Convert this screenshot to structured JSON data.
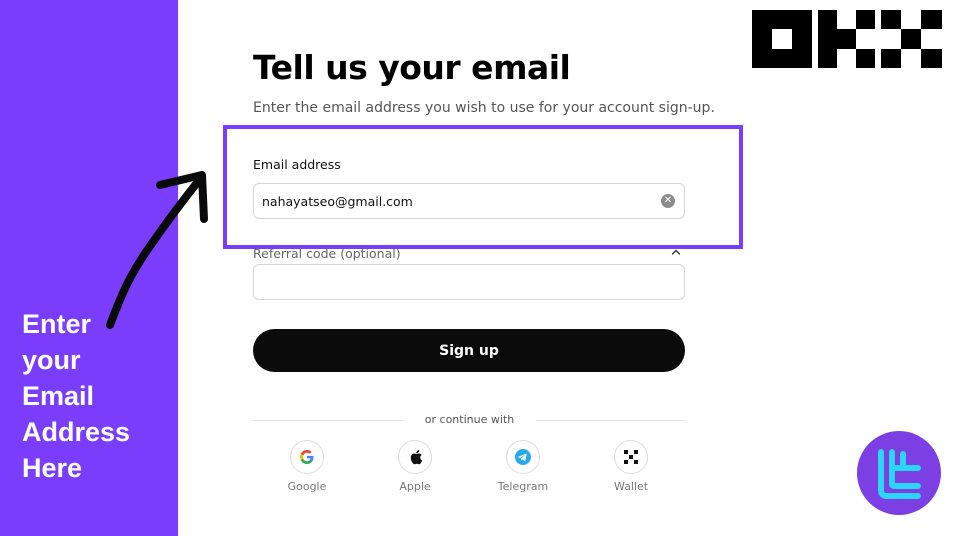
{
  "page": {
    "title": "Tell us your email",
    "subtitle": "Enter the email address you wish to use for your account sign-up."
  },
  "callout": {
    "lines": [
      "Enter",
      "your",
      "Email",
      "Address",
      "Here"
    ]
  },
  "email": {
    "label": "Email address",
    "value": "nahayatseo@gmail.com",
    "clear_icon": "close-circle-icon"
  },
  "referral": {
    "label": "Referral code (optional)",
    "value": "",
    "toggle_icon": "chevron-up-icon"
  },
  "signup": {
    "label": "Sign up"
  },
  "continue_with": {
    "text": "or continue with",
    "options": [
      {
        "label": "Google",
        "icon": "google-icon"
      },
      {
        "label": "Apple",
        "icon": "apple-icon"
      },
      {
        "label": "Telegram",
        "icon": "telegram-icon"
      },
      {
        "label": "Wallet",
        "icon": "wallet-icon"
      }
    ]
  },
  "colors": {
    "accent": "#7a3dfb",
    "button": "#0b0b0b",
    "badge_circle": "#7b3fe4",
    "badge_glyph": "#2ad5f5"
  }
}
